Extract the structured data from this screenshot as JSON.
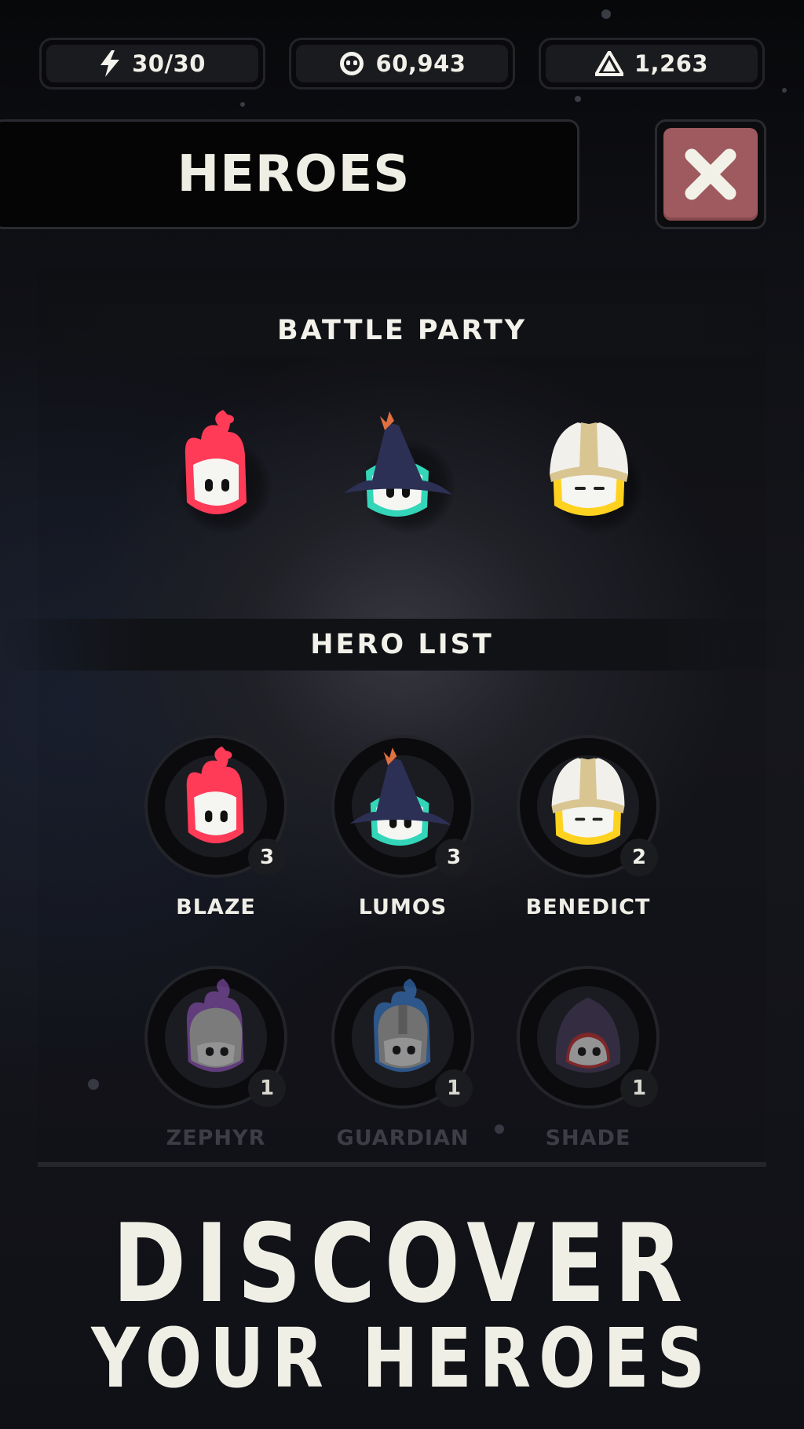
{
  "currencies": [
    {
      "icon": "lightning-icon",
      "value": "30/30"
    },
    {
      "icon": "skull-coin-icon",
      "value": "60,943"
    },
    {
      "icon": "crystal-icon",
      "value": "1,263"
    }
  ],
  "header": {
    "title": "HEROES",
    "close_icon": "close-icon"
  },
  "battle_party": {
    "label": "BATTLE PARTY",
    "members": [
      {
        "hero": "fire-spirit",
        "color": "#ff3b57"
      },
      {
        "hero": "wizard",
        "color": "#33d6b8"
      },
      {
        "hero": "priest",
        "color": "#ffd21f"
      }
    ]
  },
  "hero_list": {
    "label": "HERO LIST",
    "heroes": [
      {
        "name": "BLAZE",
        "level": "3",
        "locked": false,
        "color": "#ff3b57"
      },
      {
        "name": "LUMOS",
        "level": "3",
        "locked": false,
        "color": "#33d6b8"
      },
      {
        "name": "BENEDICT",
        "level": "2",
        "locked": false,
        "color": "#ffd21f"
      },
      {
        "name": "ZEPHYR",
        "level": "1",
        "locked": true,
        "color": "#9b59c9"
      },
      {
        "name": "GUARDIAN",
        "level": "1",
        "locked": true,
        "color": "#3d86e0"
      },
      {
        "name": "SHADE",
        "level": "1",
        "locked": true,
        "color": "#d03030"
      }
    ]
  },
  "promo": {
    "line1": "DISCOVER",
    "line2": "YOUR HEROES"
  }
}
